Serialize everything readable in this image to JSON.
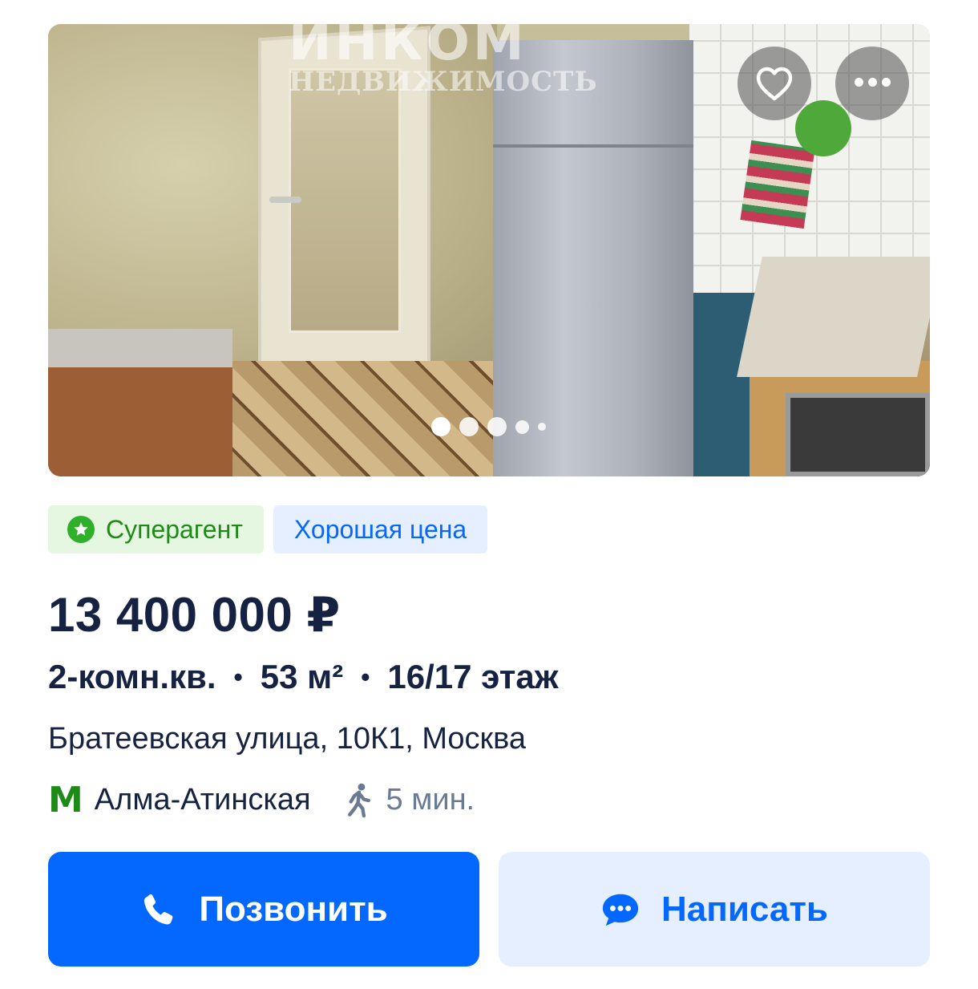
{
  "photo": {
    "watermark_brand": "ИНКОМ",
    "watermark_sub": "НЕДВИЖИМОСТЬ",
    "gallery_total": 5,
    "gallery_current": 1
  },
  "badges": {
    "superagent": "Суперагент",
    "good_price": "Хорошая цена"
  },
  "listing": {
    "price": "13 400 000 ₽",
    "rooms": "2-комн.кв.",
    "area": "53 м²",
    "floor": "16/17 этаж",
    "separator": "•",
    "address": "Братеевская улица, 10К1, Москва",
    "metro_logo": "М",
    "metro_station": "Алма-Атинская",
    "walk_time": "5 мин."
  },
  "actions": {
    "call": "Позвонить",
    "write": "Написать"
  },
  "colors": {
    "primary": "#0468ff",
    "primary_light": "#e5efff",
    "green": "#1f8a18",
    "green_light": "#e6f7e1",
    "text": "#152242",
    "muted": "#6a7a95"
  },
  "icons": [
    "heart-icon",
    "more-icon",
    "star-icon",
    "metro-icon",
    "walk-icon",
    "phone-icon",
    "chat-icon"
  ]
}
